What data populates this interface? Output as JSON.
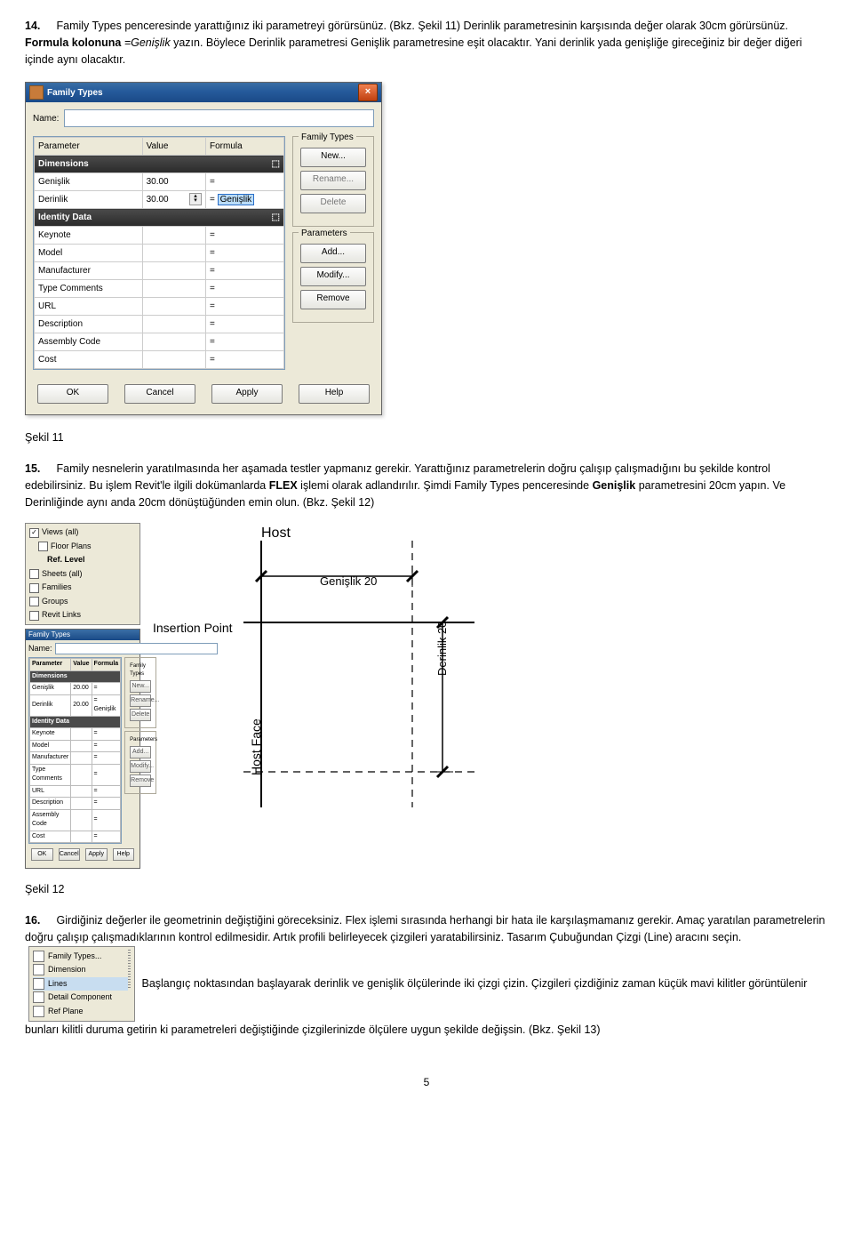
{
  "para14": {
    "num": "14.",
    "text_a": "Family Types penceresinde yarattığınız iki parametreyi görürsünüz. (Bkz. Şekil 11) Derinlik parametresinin karşısında değer olarak 30cm görürsünüz. ",
    "formula_lead": "Formula kolonuna ",
    "formula_val": "=Genişlik",
    "formula_tail": " yazın. Böylece Derinlik parametresi Genişlik parametresine eşit olacaktır. Yani derinlik yada genişliğe gireceğiniz bir değer diğeri içinde aynı olacaktır."
  },
  "ft": {
    "title": "Family Types",
    "name_label": "Name:",
    "cols": [
      "Parameter",
      "Value",
      "Formula"
    ],
    "section1": "Dimensions",
    "row_genislik": {
      "p": "Genişlik",
      "v": "30.00",
      "f": "="
    },
    "row_derinlik": {
      "p": "Derinlik",
      "v": "30.00",
      "f_prefix": "= ",
      "f_val": "Genişlik"
    },
    "section2": "Identity Data",
    "ident_rows": [
      "Keynote",
      "Model",
      "Manufacturer",
      "Type Comments",
      "URL",
      "Description",
      "Assembly Code",
      "Cost"
    ],
    "group_types": "Family Types",
    "btn_new": "New...",
    "btn_rename": "Rename...",
    "btn_delete": "Delete",
    "group_params": "Parameters",
    "btn_add": "Add...",
    "btn_modify": "Modify...",
    "btn_remove": "Remove",
    "btn_ok": "OK",
    "btn_cancel": "Cancel",
    "btn_apply": "Apply",
    "btn_help": "Help"
  },
  "cap11": "Şekil 11",
  "para15": {
    "num": "15.",
    "text_a": "Family nesnelerin yaratılmasında her aşamada testler yapmanız gerekir. Yarattığınız parametrelerin doğru çalışıp çalışmadığını bu şekilde kontrol edebilirsiniz. Bu işlem Revit'le ilgili dokümanlarda ",
    "flex": "FLEX",
    "text_b": " işlemi olarak adlandırılır. Şimdi Family Types penceresinde ",
    "gen": "Genişlik",
    "text_c": " parametresini 20cm yapın. Ve Derinliğinde aynı anda 20cm dönüştüğünden emin olun. (Bkz. Şekil 12)"
  },
  "shot12": {
    "views_header": "Views (all)",
    "views": [
      "Floor Plans",
      "Ref. Level",
      "Sheets (all)",
      "Families",
      "Groups",
      "Revit Links"
    ],
    "host": "Host",
    "insert": "Insertion Point",
    "gen": "Genişlik 20",
    "der": "Derinlik 20",
    "hostface": "Host Face",
    "mini": {
      "title": "Family Types",
      "name": "Name:",
      "cols": [
        "Parameter",
        "Value",
        "Formula"
      ],
      "sec1": "Dimensions",
      "r1": {
        "p": "Genişlik",
        "v": "20.00",
        "f": "="
      },
      "r2": {
        "p": "Derinlik",
        "v": "20.00",
        "f": "= Genişlik"
      },
      "sec2": "Identity Data",
      "ident": [
        "Keynote",
        "Model",
        "Manufacturer",
        "Type Comments",
        "URL",
        "Description",
        "Assembly Code",
        "Cost"
      ],
      "g1": "Family Types",
      "b1": "New...",
      "b2": "Rename...",
      "b3": "Delete",
      "g2": "Parameters",
      "b4": "Add...",
      "b5": "Modify...",
      "b6": "Remove",
      "ok": "OK",
      "cancel": "Cancel",
      "apply": "Apply",
      "help": "Help"
    }
  },
  "cap12": "Şekil 12",
  "para16": {
    "num": "16.",
    "text_a": "Girdiğiniz değerler ile geometrinin değiştiğini göreceksiniz. Flex işlemi sırasında herhangi bir hata ile karşılaşmamanız gerekir. Amaç yaratılan parametrelerin doğru çalışıp çalışmadıklarının kontrol edilmesidir. Artık profili belirleyecek çizgileri yaratabilirsiniz. Tasarım Çubuğundan Çizgi (Line) aracını seçin. ",
    "text_b": " Başlangıç noktasından başlayarak derinlik ve genişlik ölçülerinde iki çizgi çizin. Çizgileri çizdiğiniz zaman küçük mavi kilitler görüntülenir bunları kilitli duruma getirin ki parametreleri değiştiğinde çizgilerinizde ölçülere uygun şekilde değişsin. (Bkz. Şekil 13)"
  },
  "toolbar": {
    "items": [
      "Family Types...",
      "Dimension",
      "Lines",
      "Detail Component",
      "Ref Plane"
    ]
  },
  "page": "5"
}
